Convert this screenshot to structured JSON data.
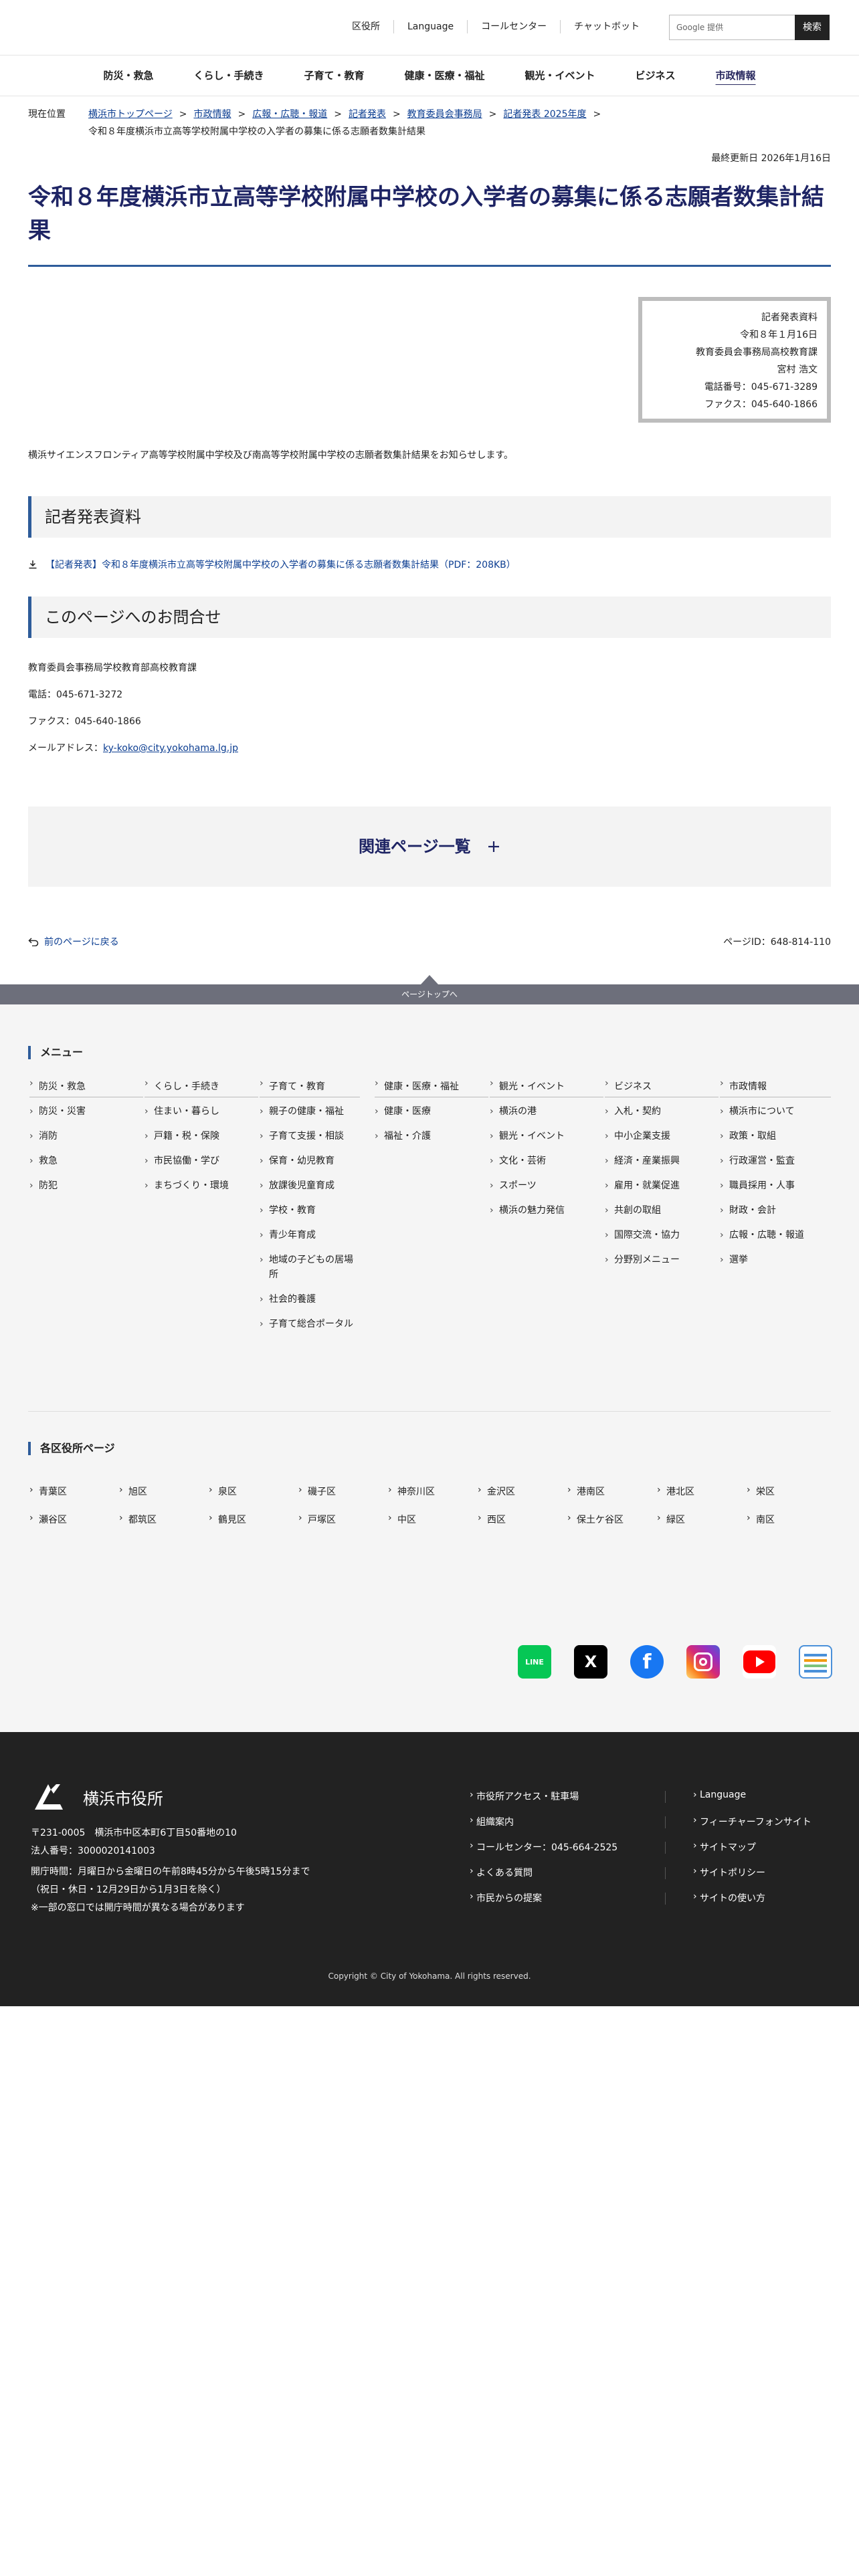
{
  "header": {
    "utility_links": [
      "区役所",
      "Language",
      "コールセンター",
      "チャットボット"
    ],
    "search_placeholder": "Google 提供",
    "search_button": "検索",
    "global_nav": [
      "防災・救急",
      "くらし・手続き",
      "子育て・教育",
      "健康・医療・福祉",
      "観光・イベント",
      "ビジネス",
      "市政情報"
    ],
    "current_nav": "市政情報"
  },
  "breadcrumb": {
    "label": "現在位置",
    "links": [
      "横浜市トップページ",
      "市政情報",
      "広報・広聴・報道",
      "記者発表",
      "教育委員会事務局",
      "記者発表 2025年度"
    ],
    "current": "令和８年度横浜市立高等学校附属中学校の入学者の募集に係る志願者数集計結果",
    "separator": ">"
  },
  "page": {
    "updated": "最終更新日 2026年1月16日",
    "title": "令和８年度横浜市立高等学校附属中学校の入学者の募集に係る志願者数集計結果",
    "info_box": [
      "記者発表資料",
      "令和８年１月16日",
      "教育委員会事務局高校教育課",
      "宮村 浩文",
      "電話番号：045-671-3289",
      "ファクス：045-640-1866"
    ],
    "lead": "横浜サイエンスフロンティア高等学校附属中学校及び南高等学校附属中学校の志願者数集計結果をお知らせします。",
    "section1_heading": "記者発表資料",
    "download_link": "【記者発表】令和８年度横浜市立高等学校附属中学校の入学者の募集に係る志願者数集計結果（PDF：208KB）",
    "section2_heading": "このページへのお問合せ",
    "contact": {
      "dept": "教育委員会事務局学校教育部高校教育課",
      "tel": "電話：045-671-3272",
      "fax": "ファクス：045-640-1866",
      "mail_label": "メールアドレス：",
      "mail": "ky-koko@city.yokohama.lg.jp"
    },
    "related": "関連ページ一覧",
    "related_icon": "plus-icon",
    "back": "前のページに戻る",
    "page_id": "ページID：648-814-110",
    "to_top": "ページトップへ"
  },
  "footer_menu": {
    "menu_heading": "メニュー",
    "columns": [
      {
        "head": "防災・救急",
        "items": [
          "防災・災害",
          "消防",
          "救急",
          "防犯"
        ]
      },
      {
        "head": "くらし・手続き",
        "items": [
          "住まい・暮らし",
          "戸籍・税・保険",
          "市民協働・学び",
          "まちづくり・環境"
        ]
      },
      {
        "head": "子育て・教育",
        "items": [
          "親子の健康・福祉",
          "子育て支援・相談",
          "保育・幼児教育",
          "放課後児童育成",
          "学校・教育",
          "青少年育成",
          "地域の子どもの居場所",
          "社会的養護",
          "子育て総合ポータル"
        ]
      },
      {
        "head": "健康・医療・福祉",
        "items": [
          "健康・医療",
          "福祉・介護"
        ]
      },
      {
        "head": "観光・イベント",
        "items": [
          "横浜の港",
          "観光・イベント",
          "文化・芸術",
          "スポーツ",
          "横浜の魅力発信"
        ]
      },
      {
        "head": "ビジネス",
        "items": [
          "入札・契約",
          "中小企業支援",
          "経済・産業振興",
          "雇用・就業促進",
          "共創の取組",
          "国際交流・協力",
          "分野別メニュー"
        ]
      },
      {
        "head": "市政情報",
        "items": [
          "横浜市について",
          "政策・取組",
          "行政運営・監査",
          "職員採用・人事",
          "財政・会計",
          "広報・広聴・報道",
          "選挙"
        ]
      }
    ],
    "wards_heading": "各区役所ページ",
    "wards": [
      "青葉区",
      "旭区",
      "泉区",
      "磯子区",
      "神奈川区",
      "金沢区",
      "港南区",
      "港北区",
      "栄区",
      "瀬谷区",
      "都筑区",
      "鶴見区",
      "戸塚区",
      "中区",
      "西区",
      "保土ケ谷区",
      "緑区",
      "南区"
    ],
    "sns": [
      {
        "name": "line-icon",
        "color": "#06c755",
        "label": "LINE"
      },
      {
        "name": "x-icon",
        "color": "#000000",
        "label": "X"
      },
      {
        "name": "facebook-icon",
        "color": "#1877f2",
        "label": "f"
      },
      {
        "name": "instagram-icon",
        "color": "#d62976",
        "label": ""
      },
      {
        "name": "youtube-icon",
        "color": "#ff0000",
        "label": ""
      },
      {
        "name": "news-icon",
        "color": "#4a90d9",
        "label": ""
      }
    ]
  },
  "footer": {
    "city_name": "横浜市役所",
    "address": "〒231-0005　横浜市中区本町6丁目50番地の10",
    "corp_no": "法人番号：3000020141003",
    "hours1": "開庁時間：月曜日から金曜日の午前8時45分から午後5時15分まで",
    "hours2": "（祝日・休日・12月29日から1月3日を除く）",
    "hours3": "※一部の窓口では開庁時間が異なる場合があります",
    "links_left": [
      "市役所アクセス・駐車場",
      "組織案内",
      "コールセンター：045-664-2525",
      "よくある質問",
      "市民からの提案"
    ],
    "links_right": [
      "Language",
      "フィーチャーフォンサイト",
      "サイトマップ",
      "サイトポリシー",
      "サイトの使い方"
    ],
    "copyright": "Copyright © City of Yokohama. All rights reserved."
  }
}
